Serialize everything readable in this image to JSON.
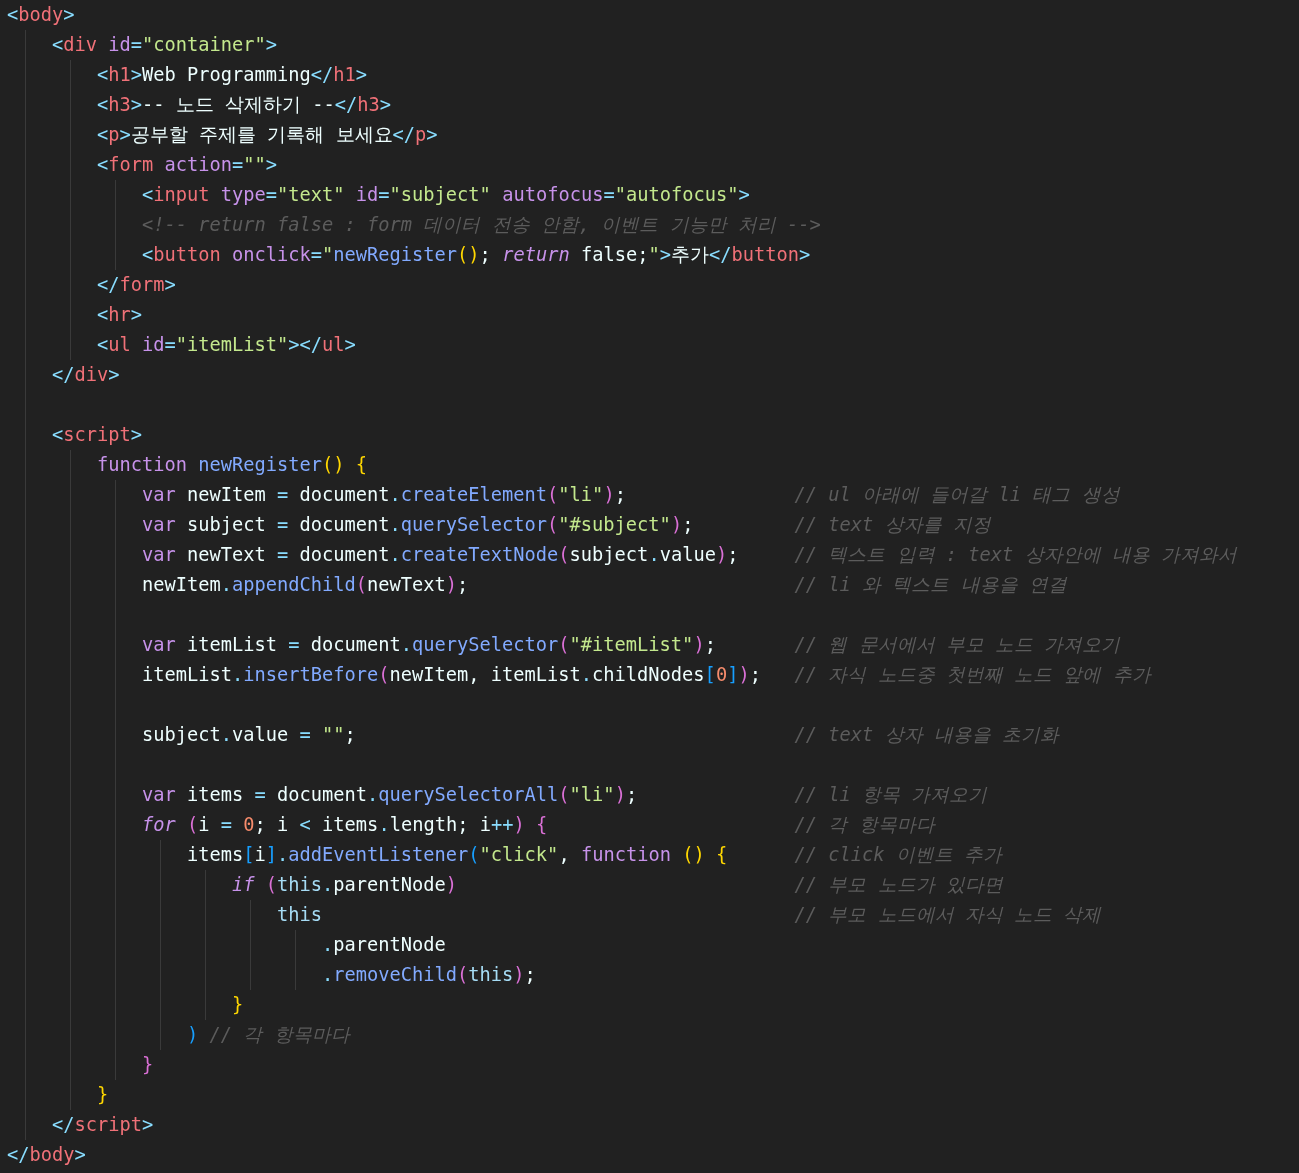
{
  "editor": {
    "lines": [
      {
        "tokens": [
          {
            "kind": "punct",
            "text": "<"
          },
          {
            "kind": "tag",
            "text": "body"
          },
          {
            "kind": "punct",
            "text": ">"
          }
        ],
        "children": [
          {
            "tokens": [
              {
                "kind": "punct",
                "text": "<"
              },
              {
                "kind": "tag",
                "text": "div"
              },
              {
                "kind": "attr",
                "text": " id"
              },
              {
                "kind": "punct",
                "text": "="
              },
              {
                "kind": "string",
                "text": "\"container\""
              },
              {
                "kind": "punct",
                "text": ">"
              }
            ],
            "children": [
              {
                "tokens": [
                  {
                    "kind": "punct",
                    "text": "<"
                  },
                  {
                    "kind": "tag",
                    "text": "h1"
                  },
                  {
                    "kind": "punct",
                    "text": ">"
                  },
                  {
                    "kind": "plain",
                    "text": "Web Programming"
                  },
                  {
                    "kind": "punct",
                    "text": "</"
                  },
                  {
                    "kind": "tag",
                    "text": "h1"
                  },
                  {
                    "kind": "punct",
                    "text": ">"
                  }
                ]
              },
              {
                "tokens": [
                  {
                    "kind": "punct",
                    "text": "<"
                  },
                  {
                    "kind": "tag",
                    "text": "h3"
                  },
                  {
                    "kind": "punct",
                    "text": ">"
                  },
                  {
                    "kind": "plain",
                    "text": "-- 노드 삭제하기 --"
                  },
                  {
                    "kind": "punct",
                    "text": "</"
                  },
                  {
                    "kind": "tag",
                    "text": "h3"
                  },
                  {
                    "kind": "punct",
                    "text": ">"
                  }
                ]
              },
              {
                "tokens": [
                  {
                    "kind": "punct",
                    "text": "<"
                  },
                  {
                    "kind": "tag",
                    "text": "p"
                  },
                  {
                    "kind": "punct",
                    "text": ">"
                  },
                  {
                    "kind": "plain",
                    "text": "공부할 주제를 기록해 보세요"
                  },
                  {
                    "kind": "punct",
                    "text": "</"
                  },
                  {
                    "kind": "tag",
                    "text": "p"
                  },
                  {
                    "kind": "punct",
                    "text": ">"
                  }
                ]
              },
              {
                "tokens": [
                  {
                    "kind": "punct",
                    "text": "<"
                  },
                  {
                    "kind": "tag",
                    "text": "form"
                  },
                  {
                    "kind": "attr",
                    "text": " action"
                  },
                  {
                    "kind": "punct",
                    "text": "="
                  },
                  {
                    "kind": "string",
                    "text": "\"\""
                  },
                  {
                    "kind": "punct",
                    "text": ">"
                  }
                ],
                "children": [
                  {
                    "tokens": [
                      {
                        "kind": "punct",
                        "text": "<"
                      },
                      {
                        "kind": "tag",
                        "text": "input"
                      },
                      {
                        "kind": "attr",
                        "text": " type"
                      },
                      {
                        "kind": "punct",
                        "text": "="
                      },
                      {
                        "kind": "string",
                        "text": "\"text\""
                      },
                      {
                        "kind": "attr",
                        "text": " id"
                      },
                      {
                        "kind": "punct",
                        "text": "="
                      },
                      {
                        "kind": "string",
                        "text": "\"subject\""
                      },
                      {
                        "kind": "attr",
                        "text": " autofocus"
                      },
                      {
                        "kind": "punct",
                        "text": "="
                      },
                      {
                        "kind": "string",
                        "text": "\"autofocus\""
                      },
                      {
                        "kind": "punct",
                        "text": ">"
                      }
                    ]
                  },
                  {
                    "tokens": [
                      {
                        "kind": "comment",
                        "text": "<!-- return false : form 데이터 전송 안함, 이벤트 기능만 처리 -->"
                      }
                    ]
                  },
                  {
                    "tokens": [
                      {
                        "kind": "punct",
                        "text": "<"
                      },
                      {
                        "kind": "tag",
                        "text": "button"
                      },
                      {
                        "kind": "attr",
                        "text": " onclick"
                      },
                      {
                        "kind": "punct",
                        "text": "="
                      },
                      {
                        "kind": "string",
                        "text": "\""
                      },
                      {
                        "kind": "function",
                        "text": "newRegister"
                      },
                      {
                        "kind": "bracket1",
                        "text": "()"
                      },
                      {
                        "kind": "plain",
                        "text": "; "
                      },
                      {
                        "kind": "control",
                        "text": "return"
                      },
                      {
                        "kind": "plain",
                        "text": " false;"
                      },
                      {
                        "kind": "string",
                        "text": "\""
                      },
                      {
                        "kind": "punct",
                        "text": ">"
                      },
                      {
                        "kind": "plain",
                        "text": "추가"
                      },
                      {
                        "kind": "punct",
                        "text": "</"
                      },
                      {
                        "kind": "tag",
                        "text": "button"
                      },
                      {
                        "kind": "punct",
                        "text": ">"
                      }
                    ]
                  }
                ]
              },
              {
                "tokens": [
                  {
                    "kind": "punct",
                    "text": "</"
                  },
                  {
                    "kind": "tag",
                    "text": "form"
                  },
                  {
                    "kind": "punct",
                    "text": ">"
                  }
                ]
              },
              {
                "tokens": [
                  {
                    "kind": "punct",
                    "text": "<"
                  },
                  {
                    "kind": "tag",
                    "text": "hr"
                  },
                  {
                    "kind": "punct",
                    "text": ">"
                  }
                ]
              },
              {
                "tokens": [
                  {
                    "kind": "punct",
                    "text": "<"
                  },
                  {
                    "kind": "tag",
                    "text": "ul"
                  },
                  {
                    "kind": "attr",
                    "text": " id"
                  },
                  {
                    "kind": "punct",
                    "text": "="
                  },
                  {
                    "kind": "string",
                    "text": "\"itemList\""
                  },
                  {
                    "kind": "punct",
                    "text": "></"
                  },
                  {
                    "kind": "tag",
                    "text": "ul"
                  },
                  {
                    "kind": "punct",
                    "text": ">"
                  }
                ]
              }
            ]
          },
          {
            "tokens": [
              {
                "kind": "punct",
                "text": "</"
              },
              {
                "kind": "tag",
                "text": "div"
              },
              {
                "kind": "punct",
                "text": ">"
              }
            ]
          },
          {
            "blank": true
          },
          {
            "tokens": [
              {
                "kind": "punct",
                "text": "<"
              },
              {
                "kind": "tag",
                "text": "script"
              },
              {
                "kind": "punct",
                "text": ">"
              }
            ],
            "children": [
              {
                "tokens": [
                  {
                    "kind": "keyword",
                    "text": "function"
                  },
                  {
                    "kind": "function",
                    "text": " newRegister"
                  },
                  {
                    "kind": "bracket1",
                    "text": "() {"
                  }
                ],
                "children": [
                  {
                    "tokens": [
                      {
                        "kind": "keyword",
                        "text": "var"
                      },
                      {
                        "kind": "plain",
                        "text": " newItem"
                      },
                      {
                        "kind": "punct",
                        "text": " = "
                      },
                      {
                        "kind": "plain",
                        "text": "document"
                      },
                      {
                        "kind": "punct",
                        "text": "."
                      },
                      {
                        "kind": "function",
                        "text": "createElement"
                      },
                      {
                        "kind": "bracket2",
                        "text": "("
                      },
                      {
                        "kind": "string",
                        "text": "\"li\""
                      },
                      {
                        "kind": "bracket2",
                        "text": ")"
                      },
                      {
                        "kind": "plain",
                        "text": ";"
                      }
                    ],
                    "comment": "// ul 아래에 들어갈 li 태그 생성"
                  },
                  {
                    "tokens": [
                      {
                        "kind": "keyword",
                        "text": "var"
                      },
                      {
                        "kind": "plain",
                        "text": " subject"
                      },
                      {
                        "kind": "punct",
                        "text": " = "
                      },
                      {
                        "kind": "plain",
                        "text": "document"
                      },
                      {
                        "kind": "punct",
                        "text": "."
                      },
                      {
                        "kind": "function",
                        "text": "querySelector"
                      },
                      {
                        "kind": "bracket2",
                        "text": "("
                      },
                      {
                        "kind": "string",
                        "text": "\"#subject\""
                      },
                      {
                        "kind": "bracket2",
                        "text": ")"
                      },
                      {
                        "kind": "plain",
                        "text": ";"
                      }
                    ],
                    "comment": "// text 상자를 지정"
                  },
                  {
                    "tokens": [
                      {
                        "kind": "keyword",
                        "text": "var"
                      },
                      {
                        "kind": "plain",
                        "text": " newText"
                      },
                      {
                        "kind": "punct",
                        "text": " = "
                      },
                      {
                        "kind": "plain",
                        "text": "document"
                      },
                      {
                        "kind": "punct",
                        "text": "."
                      },
                      {
                        "kind": "function",
                        "text": "createTextNode"
                      },
                      {
                        "kind": "bracket2",
                        "text": "("
                      },
                      {
                        "kind": "plain",
                        "text": "subject"
                      },
                      {
                        "kind": "punct",
                        "text": "."
                      },
                      {
                        "kind": "plain",
                        "text": "value"
                      },
                      {
                        "kind": "bracket2",
                        "text": ")"
                      },
                      {
                        "kind": "plain",
                        "text": ";"
                      }
                    ],
                    "comment": "// 텍스트 입력 : text 상자안에 내용 가져와서"
                  },
                  {
                    "tokens": [
                      {
                        "kind": "plain",
                        "text": "newItem"
                      },
                      {
                        "kind": "punct",
                        "text": "."
                      },
                      {
                        "kind": "function",
                        "text": "appendChild"
                      },
                      {
                        "kind": "bracket2",
                        "text": "("
                      },
                      {
                        "kind": "plain",
                        "text": "newText"
                      },
                      {
                        "kind": "bracket2",
                        "text": ")"
                      },
                      {
                        "kind": "plain",
                        "text": ";"
                      }
                    ],
                    "comment": "// li 와 텍스트 내용을 연결"
                  },
                  {
                    "blank": true
                  },
                  {
                    "tokens": [
                      {
                        "kind": "keyword",
                        "text": "var"
                      },
                      {
                        "kind": "plain",
                        "text": " itemList"
                      },
                      {
                        "kind": "punct",
                        "text": " = "
                      },
                      {
                        "kind": "plain",
                        "text": "document"
                      },
                      {
                        "kind": "punct",
                        "text": "."
                      },
                      {
                        "kind": "function",
                        "text": "querySelector"
                      },
                      {
                        "kind": "bracket2",
                        "text": "("
                      },
                      {
                        "kind": "string",
                        "text": "\"#itemList\""
                      },
                      {
                        "kind": "bracket2",
                        "text": ")"
                      },
                      {
                        "kind": "plain",
                        "text": ";"
                      }
                    ],
                    "comment": "// 웹 문서에서 부모 노드 가져오기"
                  },
                  {
                    "tokens": [
                      {
                        "kind": "plain",
                        "text": "itemList"
                      },
                      {
                        "kind": "punct",
                        "text": "."
                      },
                      {
                        "kind": "function",
                        "text": "insertBefore"
                      },
                      {
                        "kind": "bracket2",
                        "text": "("
                      },
                      {
                        "kind": "plain",
                        "text": "newItem, itemList"
                      },
                      {
                        "kind": "punct",
                        "text": "."
                      },
                      {
                        "kind": "plain",
                        "text": "childNodes"
                      },
                      {
                        "kind": "bracket3",
                        "text": "["
                      },
                      {
                        "kind": "number",
                        "text": "0"
                      },
                      {
                        "kind": "bracket3",
                        "text": "]"
                      },
                      {
                        "kind": "bracket2",
                        "text": ")"
                      },
                      {
                        "kind": "plain",
                        "text": ";"
                      }
                    ],
                    "comment": "// 자식 노드중 첫번째 노드 앞에 추가"
                  },
                  {
                    "blank": true
                  },
                  {
                    "tokens": [
                      {
                        "kind": "plain",
                        "text": "subject"
                      },
                      {
                        "kind": "punct",
                        "text": "."
                      },
                      {
                        "kind": "plain",
                        "text": "value"
                      },
                      {
                        "kind": "punct",
                        "text": " = "
                      },
                      {
                        "kind": "string",
                        "text": "\"\""
                      },
                      {
                        "kind": "plain",
                        "text": ";"
                      }
                    ],
                    "comment": "// text 상자 내용을 초기화"
                  },
                  {
                    "blank": true
                  },
                  {
                    "tokens": [
                      {
                        "kind": "keyword",
                        "text": "var"
                      },
                      {
                        "kind": "plain",
                        "text": " items"
                      },
                      {
                        "kind": "punct",
                        "text": " = "
                      },
                      {
                        "kind": "plain",
                        "text": "document"
                      },
                      {
                        "kind": "punct",
                        "text": "."
                      },
                      {
                        "kind": "function",
                        "text": "querySelectorAll"
                      },
                      {
                        "kind": "bracket2",
                        "text": "("
                      },
                      {
                        "kind": "string",
                        "text": "\"li\""
                      },
                      {
                        "kind": "bracket2",
                        "text": ")"
                      },
                      {
                        "kind": "plain",
                        "text": ";"
                      }
                    ],
                    "comment": "// li 항목 가져오기"
                  },
                  {
                    "tokens": [
                      {
                        "kind": "control",
                        "text": "for"
                      },
                      {
                        "kind": "bracket2",
                        "text": " ("
                      },
                      {
                        "kind": "plain",
                        "text": "i"
                      },
                      {
                        "kind": "punct",
                        "text": " = "
                      },
                      {
                        "kind": "number",
                        "text": "0"
                      },
                      {
                        "kind": "plain",
                        "text": "; i "
                      },
                      {
                        "kind": "punct",
                        "text": "<"
                      },
                      {
                        "kind": "plain",
                        "text": " items"
                      },
                      {
                        "kind": "punct",
                        "text": "."
                      },
                      {
                        "kind": "plain",
                        "text": "length; i"
                      },
                      {
                        "kind": "punct",
                        "text": "++"
                      },
                      {
                        "kind": "bracket2",
                        "text": ") {"
                      }
                    ],
                    "comment": "// 각 항목마다",
                    "children": [
                      {
                        "tokens": [
                          {
                            "kind": "plain",
                            "text": "items"
                          },
                          {
                            "kind": "bracket3",
                            "text": "["
                          },
                          {
                            "kind": "plain",
                            "text": "i"
                          },
                          {
                            "kind": "bracket3",
                            "text": "]"
                          },
                          {
                            "kind": "punct",
                            "text": "."
                          },
                          {
                            "kind": "function",
                            "text": "addEventListener"
                          },
                          {
                            "kind": "bracket3",
                            "text": "("
                          },
                          {
                            "kind": "string",
                            "text": "\"click\""
                          },
                          {
                            "kind": "plain",
                            "text": ", "
                          },
                          {
                            "kind": "keyword",
                            "text": "function"
                          },
                          {
                            "kind": "bracket1",
                            "text": " () {"
                          }
                        ],
                        "comment": "// click 이벤트 추가",
                        "children": [
                          {
                            "tokens": [
                              {
                                "kind": "control",
                                "text": "if"
                              },
                              {
                                "kind": "bracket2",
                                "text": " ("
                              },
                              {
                                "kind": "self",
                                "text": "this"
                              },
                              {
                                "kind": "punct",
                                "text": "."
                              },
                              {
                                "kind": "plain",
                                "text": "parentNode"
                              },
                              {
                                "kind": "bracket2",
                                "text": ")"
                              }
                            ],
                            "comment": "// 부모 노드가 있다면",
                            "children": [
                              {
                                "tokens": [
                                  {
                                    "kind": "self",
                                    "text": "this"
                                  }
                                ],
                                "comment": "// 부모 노드에서 자식 노드 삭제",
                                "children": [
                                  {
                                    "tokens": [
                                      {
                                        "kind": "punct",
                                        "text": "."
                                      },
                                      {
                                        "kind": "plain",
                                        "text": "parentNode"
                                      }
                                    ]
                                  },
                                  {
                                    "tokens": [
                                      {
                                        "kind": "punct",
                                        "text": "."
                                      },
                                      {
                                        "kind": "function",
                                        "text": "removeChild"
                                      },
                                      {
                                        "kind": "bracket2",
                                        "text": "("
                                      },
                                      {
                                        "kind": "self",
                                        "text": "this"
                                      },
                                      {
                                        "kind": "bracket2",
                                        "text": ")"
                                      },
                                      {
                                        "kind": "plain",
                                        "text": ";"
                                      }
                                    ]
                                  }
                                ]
                              }
                            ]
                          },
                          {
                            "tokens": [
                              {
                                "kind": "bracket1",
                                "text": "}"
                              }
                            ]
                          }
                        ]
                      },
                      {
                        "tokens": [
                          {
                            "kind": "bracket3",
                            "text": ")"
                          },
                          {
                            "kind": "comment",
                            "text": " // 각 항목마다"
                          }
                        ]
                      }
                    ]
                  },
                  {
                    "tokens": [
                      {
                        "kind": "bracket2",
                        "text": "}"
                      }
                    ]
                  }
                ]
              },
              {
                "tokens": [
                  {
                    "kind": "bracket1",
                    "text": "}"
                  }
                ]
              }
            ]
          },
          {
            "tokens": [
              {
                "kind": "punct",
                "text": "</"
              },
              {
                "kind": "tag",
                "text": "script"
              },
              {
                "kind": "punct",
                "text": ">"
              }
            ]
          }
        ]
      },
      {
        "tokens": [
          {
            "kind": "punct",
            "text": "</"
          },
          {
            "kind": "tag",
            "text": "body"
          },
          {
            "kind": "punct",
            "text": ">"
          }
        ]
      }
    ]
  }
}
